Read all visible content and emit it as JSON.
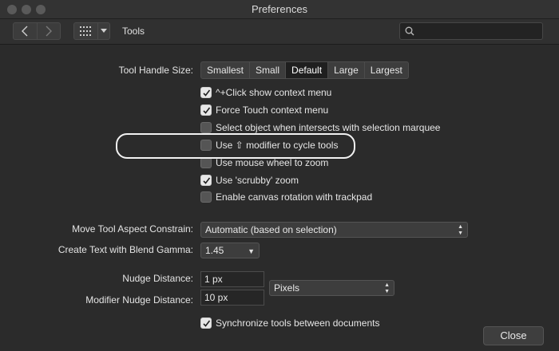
{
  "window": {
    "title": "Preferences"
  },
  "toolbar": {
    "pane_title": "Tools",
    "search_placeholder": "",
    "search_value": ""
  },
  "tool_handle_size": {
    "label": "Tool Handle Size:",
    "options": [
      "Smallest",
      "Small",
      "Default",
      "Large",
      "Largest"
    ],
    "selected": "Default"
  },
  "checkboxes": [
    {
      "label": "^+Click show context menu",
      "checked": true
    },
    {
      "label": "Force Touch context menu",
      "checked": true
    },
    {
      "label": "Select object when intersects with selection marquee",
      "checked": false
    },
    {
      "label": "Use ⇧ modifier to cycle tools",
      "checked": false
    },
    {
      "label": "Use mouse wheel to zoom",
      "checked": false
    },
    {
      "label": "Use 'scrubby' zoom",
      "checked": true
    },
    {
      "label": "Enable canvas rotation with trackpad",
      "checked": false
    }
  ],
  "move_tool": {
    "label": "Move Tool Aspect Constrain:",
    "value": "Automatic (based on selection)"
  },
  "blend_gamma": {
    "label": "Create Text with Blend Gamma:",
    "value": "1.45"
  },
  "nudge": {
    "label": "Nudge Distance:",
    "value": "1 px",
    "modifier_label": "Modifier Nudge Distance:",
    "modifier_value": "10 px",
    "unit": "Pixels"
  },
  "sync": {
    "label": "Synchronize tools between documents",
    "checked": true
  },
  "close_label": "Close"
}
